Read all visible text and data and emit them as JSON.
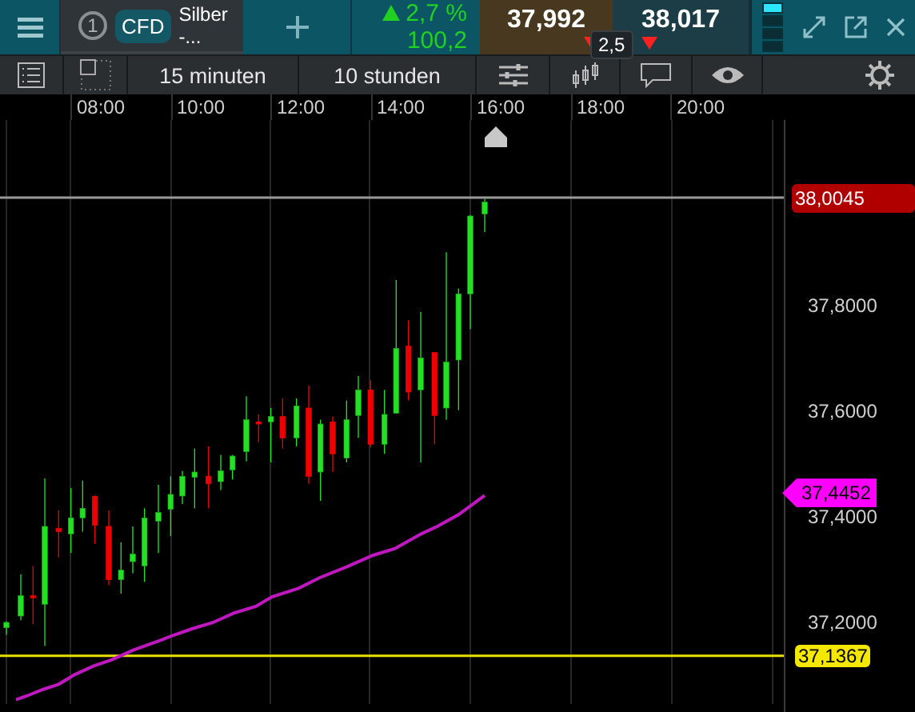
{
  "instrument_tab": {
    "number": "1",
    "type": "CFD",
    "name_lines": [
      "Silber",
      "-..."
    ]
  },
  "change": {
    "percent": "2,7 %",
    "points": "100,2"
  },
  "quotes": {
    "sell": "37,992",
    "buy": "38,017",
    "spread": "2,5"
  },
  "toolbar": {
    "interval": "15 minuten",
    "range": "10 stunden"
  },
  "time_axis": [
    "08:00",
    "10:00",
    "12:00",
    "14:00",
    "16:00",
    "18:00",
    "20:00"
  ],
  "price_axis": [
    "37,8000",
    "37,6000",
    "37,4000",
    "37,2000"
  ],
  "price_tags": [
    {
      "kind": "last",
      "text": "38,0045"
    },
    {
      "kind": "average",
      "text": "37,4452"
    },
    {
      "kind": "level",
      "text": "37,1367"
    }
  ]
}
